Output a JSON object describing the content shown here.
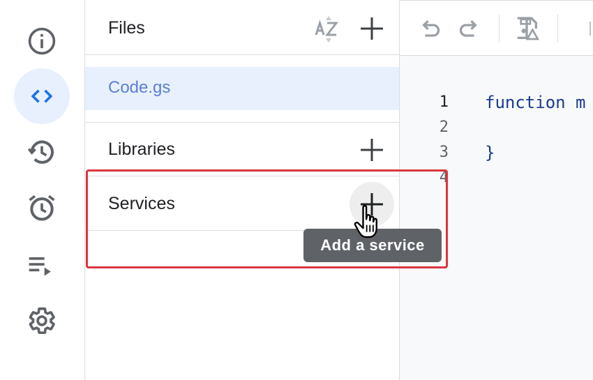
{
  "sidebar": {
    "items": [
      {
        "name": "overview",
        "icon": "info-icon",
        "active": false
      },
      {
        "name": "editor",
        "icon": "code-icon",
        "active": true
      },
      {
        "name": "executions",
        "icon": "history-icon",
        "active": false
      },
      {
        "name": "triggers",
        "icon": "alarm-icon",
        "active": false
      },
      {
        "name": "executions-list",
        "icon": "playlist-play-icon",
        "active": false
      },
      {
        "name": "settings",
        "icon": "gear-icon",
        "active": false
      }
    ]
  },
  "files_panel": {
    "files_title": "Files",
    "sort_icon": "sort-az-icon",
    "files": [
      "Code.gs"
    ],
    "libraries_title": "Libraries",
    "services_title": "Services",
    "tooltip": "Add a service"
  },
  "editor": {
    "toolbar_icons": [
      "undo-icon",
      "redo-icon",
      "save-icon"
    ],
    "line_numbers": [
      "1",
      "2",
      "3",
      "4"
    ],
    "code_lines": [
      "function m",
      "",
      "}",
      ""
    ]
  },
  "colors": {
    "accent": "#1a73e8",
    "active_bg": "#e8f0fe",
    "highlight_border": "#d9363e",
    "tooltip_bg": "#5f6368"
  }
}
